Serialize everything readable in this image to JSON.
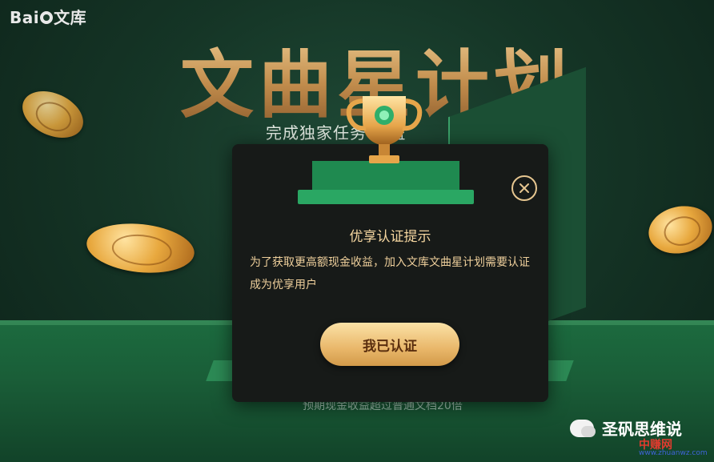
{
  "brand": {
    "logo_text_left": "Bai",
    "logo_text_right": "文库"
  },
  "hero": {
    "title": "文曲星计划",
    "subtitle": "完成独家任务                收益",
    "bottom_text": "预期现金收益超过普通文档20倍"
  },
  "modal": {
    "title": "优享认证提示",
    "body": "为了获取更高额现金收益，加入文库文曲星计划需要认证成为优享用户",
    "confirm_label": "我已认证",
    "close_icon": "close-circle-icon"
  },
  "watermark": {
    "channel_name": "圣矾思维说",
    "site_name": "中赚网",
    "site_url": "www.zhuanwz.com"
  },
  "colors": {
    "accent_gold": "#e9b76a",
    "modal_bg": "#171a18",
    "modal_text": "#eecf9b",
    "scene_green": "#1c6b3f"
  }
}
